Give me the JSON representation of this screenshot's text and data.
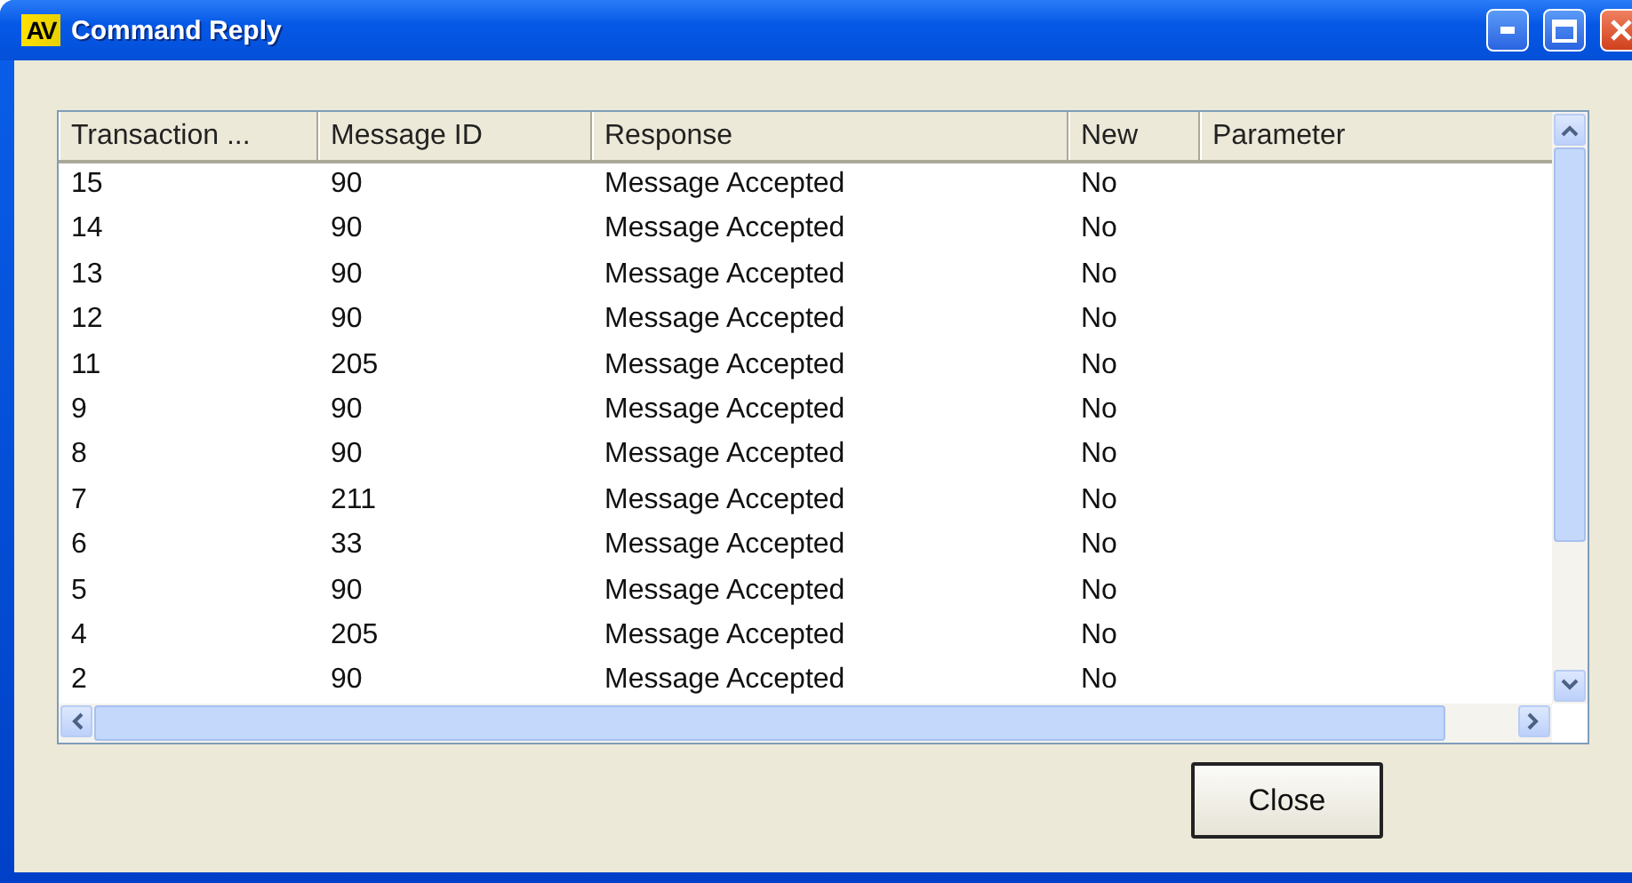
{
  "window": {
    "title": "Command Reply",
    "icon_text": "AV"
  },
  "table": {
    "columns": [
      "Transaction ...",
      "Message ID",
      "Response",
      "New",
      "Parameter"
    ],
    "rows": [
      [
        "15",
        "90",
        "Message Accepted",
        "No"
      ],
      [
        "14",
        "90",
        "Message Accepted",
        "No"
      ],
      [
        "13",
        "90",
        "Message Accepted",
        "No"
      ],
      [
        "12",
        "90",
        "Message Accepted",
        "No"
      ],
      [
        "11",
        "205",
        "Message Accepted",
        "No"
      ],
      [
        "9",
        "90",
        "Message Accepted",
        "No"
      ],
      [
        "8",
        "90",
        "Message Accepted",
        "No"
      ],
      [
        "7",
        "211",
        "Message Accepted",
        "No"
      ],
      [
        "6",
        "33",
        "Message Accepted",
        "No"
      ],
      [
        "5",
        "90",
        "Message Accepted",
        "No"
      ],
      [
        "4",
        "205",
        "Message Accepted",
        "No"
      ],
      [
        "2",
        "90",
        "Message Accepted",
        "No"
      ]
    ]
  },
  "buttons": [
    "Close"
  ]
}
